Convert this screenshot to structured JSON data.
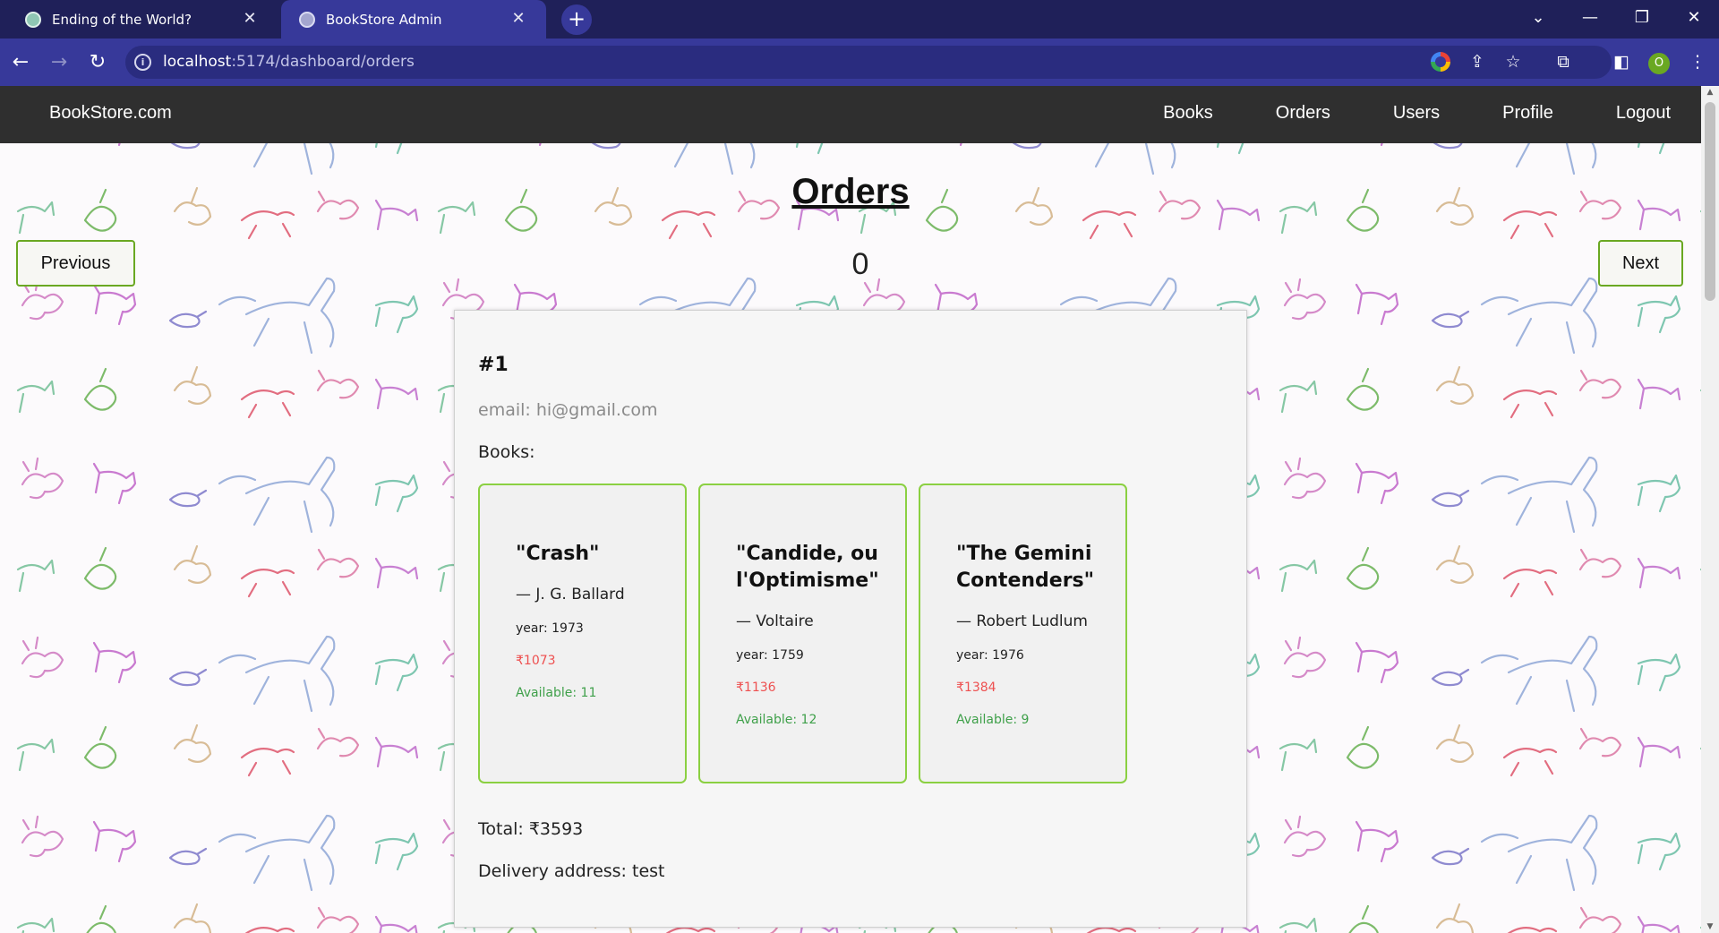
{
  "browser": {
    "tabs": [
      {
        "title": "Ending of the World?"
      },
      {
        "title": "BookStore Admin"
      }
    ],
    "url_host": "localhost",
    "url_rest": ":5174/dashboard/orders"
  },
  "appnav": {
    "brand": "BookStore.com",
    "links": [
      "Books",
      "Orders",
      "Users",
      "Profile",
      "Logout"
    ]
  },
  "page": {
    "title": "Orders",
    "prev_label": "Previous",
    "next_label": "Next",
    "page_number": "0"
  },
  "order": {
    "id": "#1",
    "email": "email: hi@gmail.com",
    "books_label": "Books:",
    "books": [
      {
        "title": "\"Crash\"",
        "author": "— J. G. Ballard",
        "year": "year: 1973",
        "price": "₹1073",
        "available": "Available: 11"
      },
      {
        "title": "\"Candide, ou l'Optimisme\"",
        "author": "— Voltaire",
        "year": "year: 1759",
        "price": "₹1136",
        "available": "Available: 12"
      },
      {
        "title": "\"The Gemini Contenders\"",
        "author": "— Robert Ludlum",
        "year": "year: 1976",
        "price": "₹1384",
        "available": "Available: 9"
      }
    ],
    "total": "Total: ₹3593",
    "address": "Delivery address: test"
  },
  "profile_initial": "O"
}
